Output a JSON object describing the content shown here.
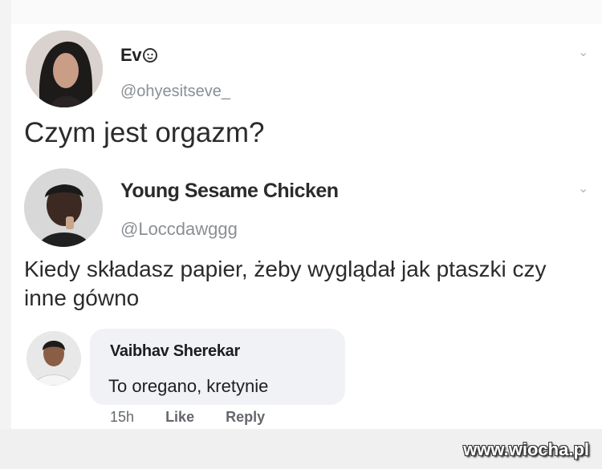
{
  "tweet1": {
    "display_name": "Ev",
    "handle": "@ohyesitseve_",
    "text": "Czym jest orgazm?"
  },
  "tweet2": {
    "display_name": "Young Sesame Chicken",
    "handle": "@Loccdawggg",
    "text": "Kiedy składasz papier, żeby wyglądał jak ptaszki czy inne gówno"
  },
  "comment": {
    "author": "Vaibhav Sherekar",
    "text": "To oregano, kretynie",
    "time": "15h",
    "like_label": "Like",
    "reply_label": "Reply"
  },
  "watermark": "www.wiocha.pl",
  "icons": {
    "badge": "lion-face-icon",
    "menu": "chevron-down-icon"
  }
}
